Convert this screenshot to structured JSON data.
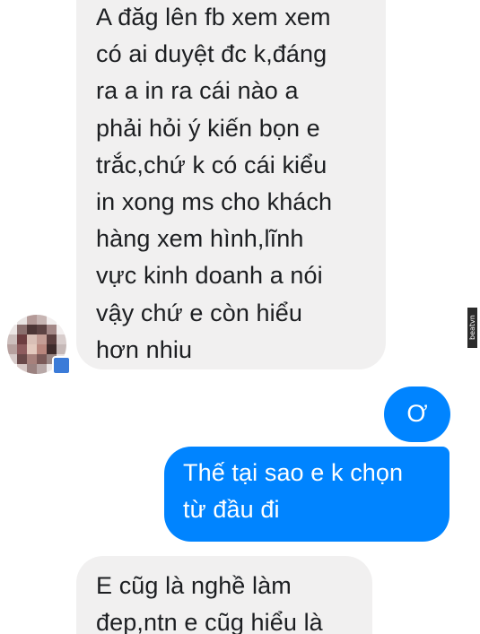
{
  "messages": [
    {
      "id": "msg1",
      "direction": "incoming",
      "text": "A đăg lên fb xem xem\ncó ai duyệt đc k,đáng\nra a in ra cái nào a\nphải hỏi ý kiến bọn e\ntrắc,chứ k có cái kiểu\nin xong ms cho khách\nhàng xem hình,lĩnh\nvực kinh doanh a nói\nvậy chứ e còn hiểu\nhơn nhiu"
    },
    {
      "id": "msg2",
      "direction": "outgoing",
      "text": "Ơ"
    },
    {
      "id": "msg3",
      "direction": "outgoing",
      "text": "Thế tại sao e k chọn\ntừ đầu đi"
    },
    {
      "id": "msg4",
      "direction": "incoming",
      "text": "E cũg là nghề làm\nđep,ntn e cũg hiểu là"
    }
  ],
  "avatar": {
    "icon": "pixelated-profile-photo",
    "presence_icon": "messenger-badge-icon"
  },
  "watermark": {
    "text": "beatvn"
  },
  "colors": {
    "incoming_bubble": "#f1f0f0",
    "outgoing_bubble": "#0084ff",
    "incoming_text": "#1c1e21",
    "outgoing_text": "#ffffff"
  }
}
